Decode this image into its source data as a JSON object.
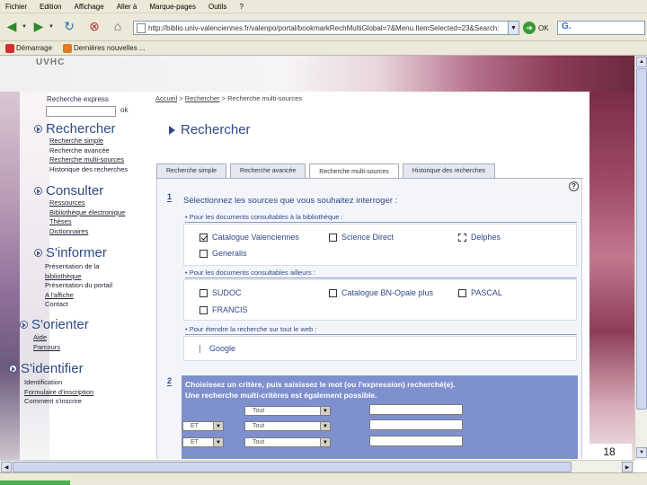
{
  "menu": [
    "Fichier",
    "Edition",
    "Affichage",
    "Aller à",
    "Marque-pages",
    "Outils",
    "?"
  ],
  "urlbar": {
    "value": "http://biblio.univ-valenciennes.fr/valenpo/portal/bookmarkRechMultiGlobal=?&Menu.ItemSelected=23&Search:",
    "go_label": "OK",
    "search_value": "G."
  },
  "bookmarks": [
    "Démarrage",
    "Dernières nouvelles ..."
  ],
  "logo": "UVHC",
  "express": {
    "label": "Recherche express",
    "ok": "ok"
  },
  "sections": [
    {
      "label": "Rechercher",
      "items": [
        "Recherche simple",
        "Recherche avancée",
        "Recherche multi-sources",
        "Historique des recherches"
      ]
    },
    {
      "label": "Consulter",
      "items": [
        "Ressources",
        "Bibliothèque électronique",
        "Thèses",
        "Dictionnaires"
      ]
    },
    {
      "label": "S'informer",
      "items": [
        "Présentation de la",
        "bibliothèque",
        "Présentation du portail",
        "A l'affiche",
        "Contact"
      ]
    },
    {
      "label": "S'orienter",
      "items": [
        "Aide",
        "Parcours"
      ]
    },
    {
      "label": "S'identifier",
      "items": [
        "Identification",
        "Formulaire d'inscription",
        "Comment s'inscrire"
      ]
    }
  ],
  "breadcrumb": {
    "home": "Accueil",
    "sep": ">",
    "b1": "Rechercher",
    "b2": "Recherche multi-sources"
  },
  "page_title": "Rechercher",
  "tabs": [
    "Recherche simple",
    "Recherche avancée",
    "Recherche multi-sources",
    "Historique des recherches"
  ],
  "help": "?",
  "step1": {
    "num": "1",
    "text": "Sélectionnez les sources que vous souhaitez interroger :",
    "groups": [
      {
        "title": "• Pour les documents consultables à la bibliothèque :",
        "sources": [
          {
            "label": "Catalogue Valenciennes",
            "checked": true
          },
          {
            "label": "Science Direct",
            "checked": false
          },
          {
            "label": "Delphes",
            "checked": false
          },
          {
            "label": "Generalis",
            "checked": false
          }
        ]
      },
      {
        "title": "• Pour les documents consultables ailleurs :",
        "sources": [
          {
            "label": "SUDOC",
            "checked": false
          },
          {
            "label": "Catalogue BN-Opale plus",
            "checked": false
          },
          {
            "label": "PASCAL",
            "checked": false
          },
          {
            "label": "FRANCIS",
            "checked": false
          }
        ]
      },
      {
        "title": "• Pour étendre la recherche sur tout le web :",
        "sources": [
          {
            "label": "Google",
            "checked": false
          }
        ]
      }
    ]
  },
  "step2": {
    "num": "2",
    "line1": "Choisissez un critère, puis saisissez le mot (ou l'expression) recherché(e).",
    "line2": "Une recherche multi-critères est également possible.",
    "operators": [
      "ET",
      "ET"
    ],
    "criteria": [
      "Tout",
      "Tout",
      "Tout"
    ]
  },
  "slide_number": "18"
}
